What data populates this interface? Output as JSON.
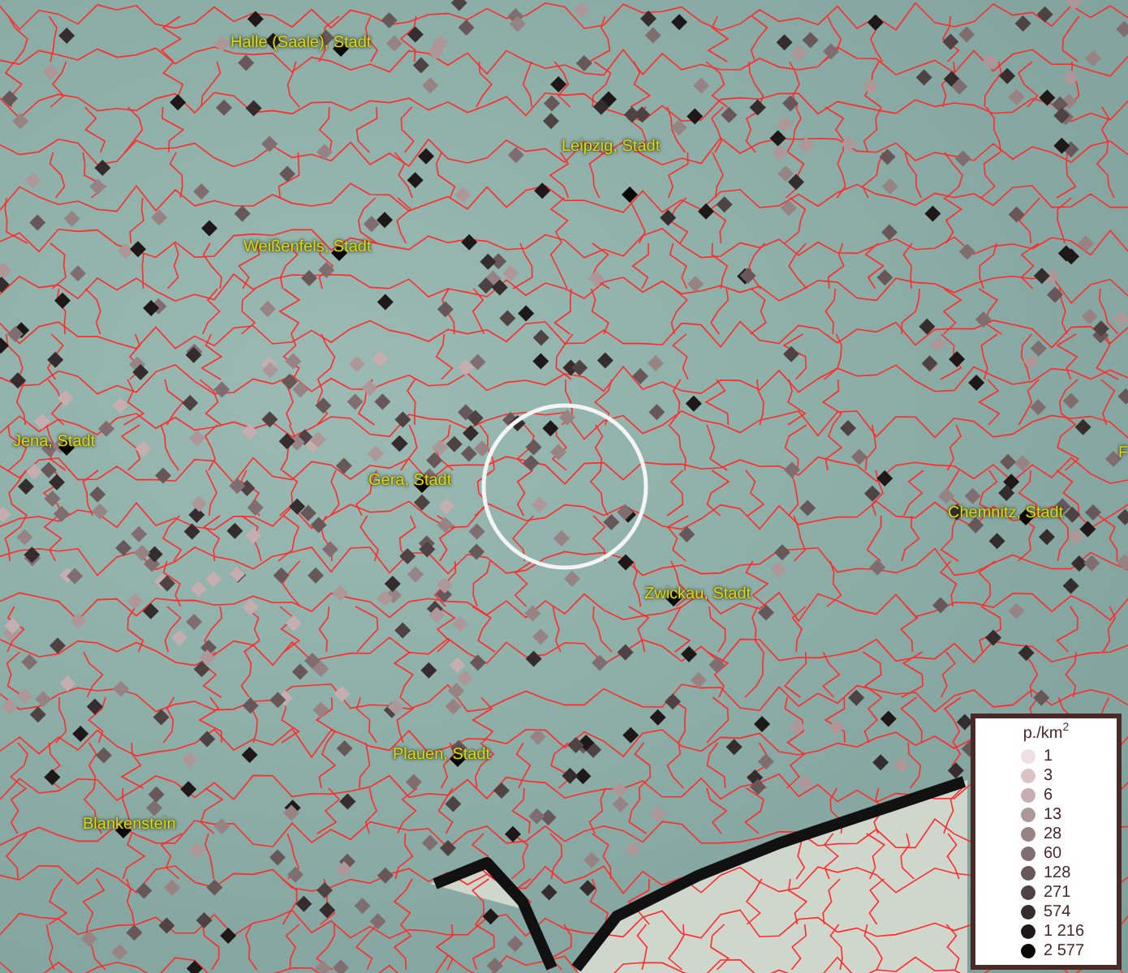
{
  "places": [
    {
      "name": "Halle (Saale), Stadt"
    },
    {
      "name": "Leipzig, Stadt"
    },
    {
      "name": "Weißenfels, Stadt"
    },
    {
      "name": "Jena, Stadt"
    },
    {
      "name": "Gera, Stadt"
    },
    {
      "name": "Chemnitz, Stadt"
    },
    {
      "name": "Zwickau, Stadt"
    },
    {
      "name": "Plauen, Stadt"
    },
    {
      "name": "Blankenstein"
    },
    {
      "name": "F"
    }
  ],
  "legend": {
    "title": "p./km$^{2}$",
    "items": [
      {
        "label": "1",
        "color": "#efdfe0"
      },
      {
        "label": "3",
        "color": "#d9c3c5"
      },
      {
        "label": "6",
        "color": "#c4aeb0"
      },
      {
        "label": "13",
        "color": "#ad9799"
      },
      {
        "label": "28",
        "color": "#978284"
      },
      {
        "label": "60",
        "color": "#7f6d6f"
      },
      {
        "label": "128",
        "color": "#675759"
      },
      {
        "label": "271",
        "color": "#4e4243"
      },
      {
        "label": "574",
        "color": "#352c2d"
      },
      {
        "label": "1 216",
        "color": "#1e1819"
      },
      {
        "label": "2 577",
        "color": "#0a0707"
      }
    ]
  }
}
